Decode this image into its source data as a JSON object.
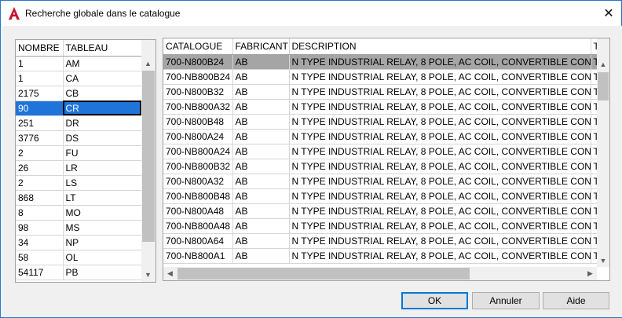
{
  "window": {
    "title": "Recherche globale dans le catalogue",
    "close_glyph": "✕"
  },
  "left_table": {
    "headers": [
      "NOMBRE",
      "TABLEAU"
    ],
    "selected_index": 3,
    "rows": [
      [
        "1",
        "AM"
      ],
      [
        "1",
        "CA"
      ],
      [
        "2175",
        "CB"
      ],
      [
        "90",
        "CR"
      ],
      [
        "251",
        "DR"
      ],
      [
        "3776",
        "DS"
      ],
      [
        "2",
        "FU"
      ],
      [
        "26",
        "LR"
      ],
      [
        "2",
        "LS"
      ],
      [
        "868",
        "LT"
      ],
      [
        "8",
        "MO"
      ],
      [
        "98",
        "MS"
      ],
      [
        "34",
        "NP"
      ],
      [
        "58",
        "OL"
      ],
      [
        "54117",
        "PB"
      ]
    ]
  },
  "right_table": {
    "headers": [
      "CATALOGUE",
      "FABRICANT",
      "DESCRIPTION",
      "T"
    ],
    "selected_index": 0,
    "rows": [
      [
        "700-N800B24",
        "AB",
        "N TYPE INDUSTRIAL RELAY, 8 POLE, AC COIL, CONVERTIBLE CONTACTS",
        "T"
      ],
      [
        "700-NB800B24",
        "AB",
        "N TYPE INDUSTRIAL RELAY, 8 POLE, AC COIL, CONVERTIBLE CONTACTS",
        "T"
      ],
      [
        "700-N800B32",
        "AB",
        "N TYPE INDUSTRIAL RELAY, 8 POLE, AC COIL, CONVERTIBLE CONTACTS",
        "T"
      ],
      [
        "700-NB800A32",
        "AB",
        "N TYPE INDUSTRIAL RELAY, 8 POLE, AC COIL, CONVERTIBLE CONTACTS",
        "T"
      ],
      [
        "700-N800B48",
        "AB",
        "N TYPE INDUSTRIAL RELAY, 8 POLE, AC COIL, CONVERTIBLE CONTACTS",
        "T"
      ],
      [
        "700-N800A24",
        "AB",
        "N TYPE INDUSTRIAL RELAY, 8 POLE, AC COIL, CONVERTIBLE CONTACTS",
        "T"
      ],
      [
        "700-NB800A24",
        "AB",
        "N TYPE INDUSTRIAL RELAY, 8 POLE, AC COIL, CONVERTIBLE CONTACTS",
        "T"
      ],
      [
        "700-NB800B32",
        "AB",
        "N TYPE INDUSTRIAL RELAY, 8 POLE, AC COIL, CONVERTIBLE CONTACTS",
        "T"
      ],
      [
        "700-N800A32",
        "AB",
        "N TYPE INDUSTRIAL RELAY, 8 POLE, AC COIL, CONVERTIBLE CONTACTS",
        "T"
      ],
      [
        "700-NB800B48",
        "AB",
        "N TYPE INDUSTRIAL RELAY, 8 POLE, AC COIL, CONVERTIBLE CONTACTS",
        "T"
      ],
      [
        "700-N800A48",
        "AB",
        "N TYPE INDUSTRIAL RELAY, 8 POLE, AC COIL, CONVERTIBLE CONTACTS",
        "T"
      ],
      [
        "700-NB800A48",
        "AB",
        "N TYPE INDUSTRIAL RELAY, 8 POLE, AC COIL, CONVERTIBLE CONTACTS",
        "T"
      ],
      [
        "700-N800A64",
        "AB",
        "N TYPE INDUSTRIAL RELAY, 8 POLE, AC COIL, CONVERTIBLE CONTACTS",
        "T"
      ],
      [
        "700-NB800A1",
        "AB",
        "N TYPE INDUSTRIAL RELAY, 8 POLE, AC COIL, CONVERTIBLE CONTACTS",
        "T"
      ]
    ]
  },
  "buttons": {
    "ok": "OK",
    "cancel": "Annuler",
    "help": "Aide"
  },
  "icons": {
    "app": "autocad-icon",
    "scroll_up": "▲",
    "scroll_down": "▼",
    "scroll_left": "◀",
    "scroll_right": "▶"
  },
  "colors": {
    "selection": "#1e74d9",
    "inactive_selection": "#a5a5a5",
    "app_icon": "#c8102e"
  }
}
